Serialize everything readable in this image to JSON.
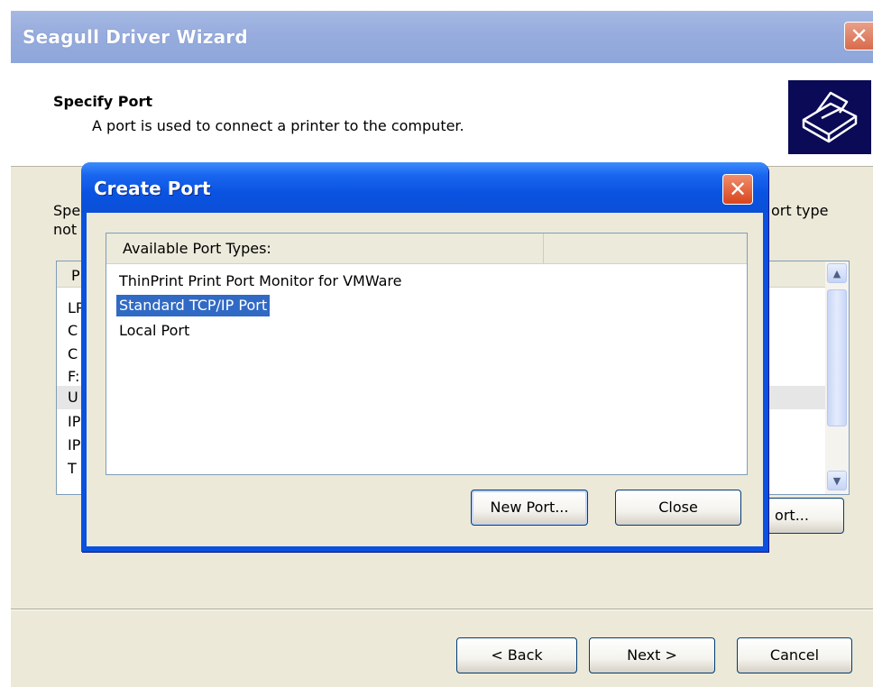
{
  "wizard": {
    "title": "Seagull Driver Wizard",
    "close_glyph": "✕",
    "header": {
      "title": "Specify Port",
      "subtitle": "A port is used to connect a printer to the computer."
    },
    "body_text_left_line1": "Spe",
    "body_text_left_line2": "not",
    "body_text_right": "ort type",
    "port_list": {
      "header_fragment": "P",
      "row_fragments": [
        "LP",
        "C",
        "C",
        "F:",
        "U",
        "IP",
        "IP",
        "T"
      ]
    },
    "port_button_fragment": "ort...",
    "buttons": {
      "back": "< Back",
      "next": "Next >",
      "cancel": "Cancel"
    },
    "logo_icon": "printer-icon"
  },
  "dialog": {
    "title": "Create Port",
    "close_glyph": "✕",
    "list": {
      "column_header": "Available Port Types:",
      "items": [
        "ThinPrint Print Port Monitor for VMWare",
        "Standard TCP/IP Port",
        "Local Port"
      ],
      "selected_index": 1
    },
    "buttons": {
      "new_port": "New Port...",
      "close": "Close"
    }
  },
  "colors": {
    "dialog_title_blue": "#0a53e2",
    "selection_blue": "#316ac5",
    "window_face": "#ece9d8"
  }
}
